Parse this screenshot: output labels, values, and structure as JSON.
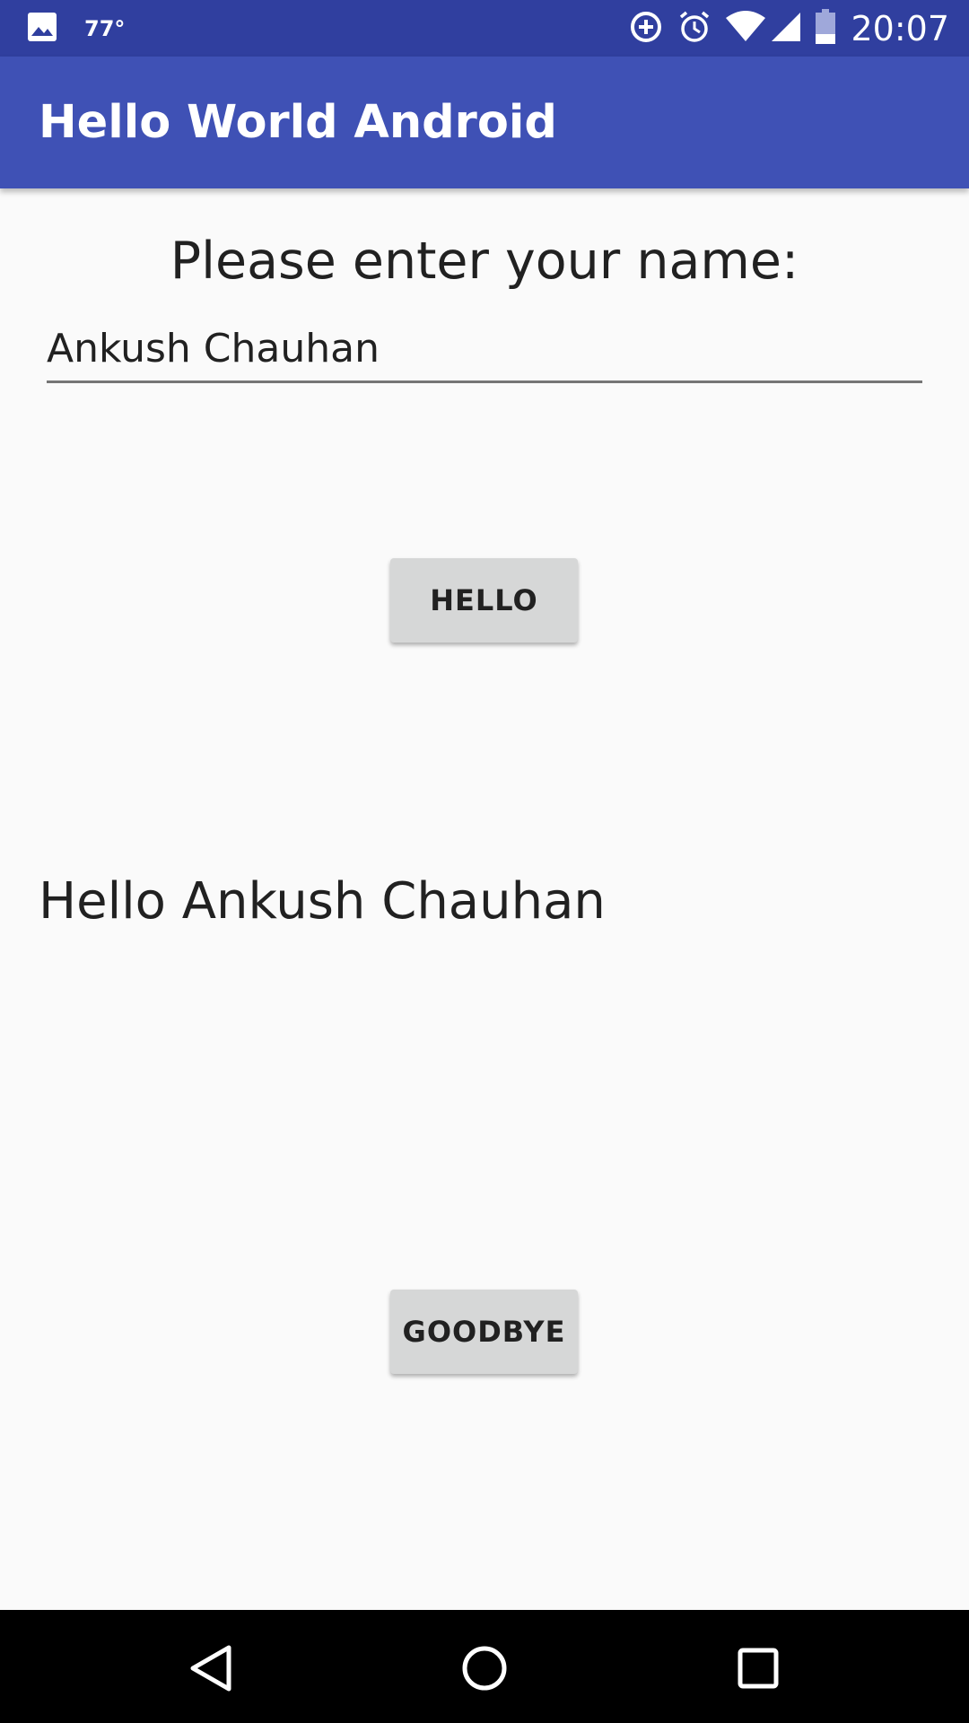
{
  "status_bar": {
    "temperature": "77°",
    "time": "20:07",
    "icons": [
      "image-icon",
      "data-saver-icon",
      "alarm-icon",
      "wifi-icon",
      "signal-icon",
      "battery-icon"
    ]
  },
  "app_bar": {
    "title": "Hello World Android"
  },
  "form": {
    "prompt": "Please enter your name:",
    "name_value": "Ankush Chauhan",
    "hello_label": "HELLO",
    "goodbye_label": "GOODBYE"
  },
  "greeting": {
    "text": "Hello Ankush Chauhan"
  },
  "navigation": {
    "icons": [
      "back-icon",
      "home-icon",
      "recents-icon"
    ]
  },
  "colors": {
    "status_bar": "#303f9f",
    "app_bar": "#3f51b5",
    "background": "#fafafa",
    "button": "#d6d7d7"
  }
}
